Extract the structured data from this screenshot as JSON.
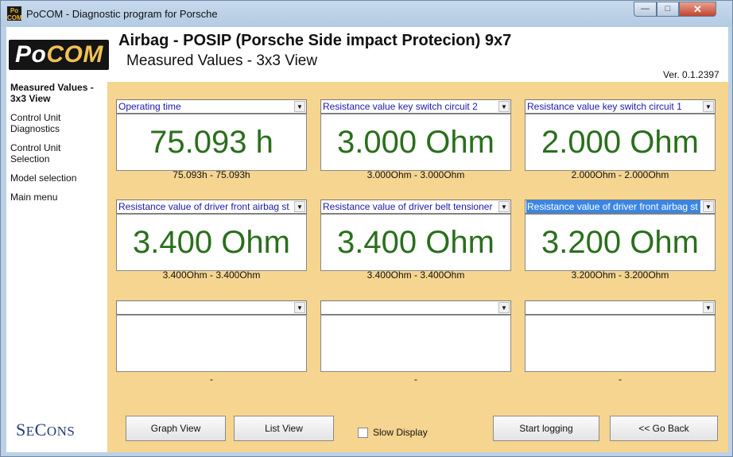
{
  "window": {
    "title": "PoCOM - Diagnostic program for Porsche",
    "icon_text": "Po\nCOM",
    "controls": {
      "minimize": "—",
      "maximize": "□",
      "close": "✕"
    }
  },
  "logo": {
    "part1": "Po",
    "part2": "COM"
  },
  "header": {
    "title": "Airbag - POSIP (Porsche Side impact Protecion) 9x7",
    "subtitle": "Measured Values - 3x3 View",
    "version": "Ver. 0.1.2397"
  },
  "sidebar": {
    "items": [
      {
        "label": "Measured Values - 3x3 View",
        "active": true
      },
      {
        "label": "Control Unit Diagnostics"
      },
      {
        "label": "Control Unit Selection"
      },
      {
        "label": "Model selection"
      },
      {
        "label": "Main menu"
      }
    ]
  },
  "brand": {
    "big1": "S",
    "small1": "E",
    "big2": "C",
    "small2": "ONS"
  },
  "cells": [
    {
      "label": "Operating time",
      "value": "75.093 h",
      "range": "75.093h - 75.093h"
    },
    {
      "label": "Resistance value key switch circuit 2",
      "value": "3.000 Ohm",
      "range": "3.000Ohm - 3.000Ohm"
    },
    {
      "label": "Resistance value key switch circuit 1",
      "value": "2.000 Ohm",
      "range": "2.000Ohm - 2.000Ohm"
    },
    {
      "label": "Resistance value of driver front airbag st",
      "value": "3.400 Ohm",
      "range": "3.400Ohm - 3.400Ohm"
    },
    {
      "label": "Resistance value of driver belt tensioner",
      "value": "3.400 Ohm",
      "range": "3.400Ohm - 3.400Ohm"
    },
    {
      "label": "Resistance value of driver front airbag st",
      "value": "3.200 Ohm",
      "range": "3.200Ohm - 3.200Ohm",
      "highlighted": true
    },
    {
      "label": "",
      "value": "",
      "range": "-"
    },
    {
      "label": "",
      "value": "",
      "range": "-"
    },
    {
      "label": "",
      "value": "",
      "range": "-"
    }
  ],
  "buttons": {
    "graph_view": "Graph View",
    "list_view": "List View",
    "slow_display": "Slow Display",
    "start_logging": "Start logging",
    "go_back": "<< Go Back"
  },
  "arrow_glyph": "▼"
}
